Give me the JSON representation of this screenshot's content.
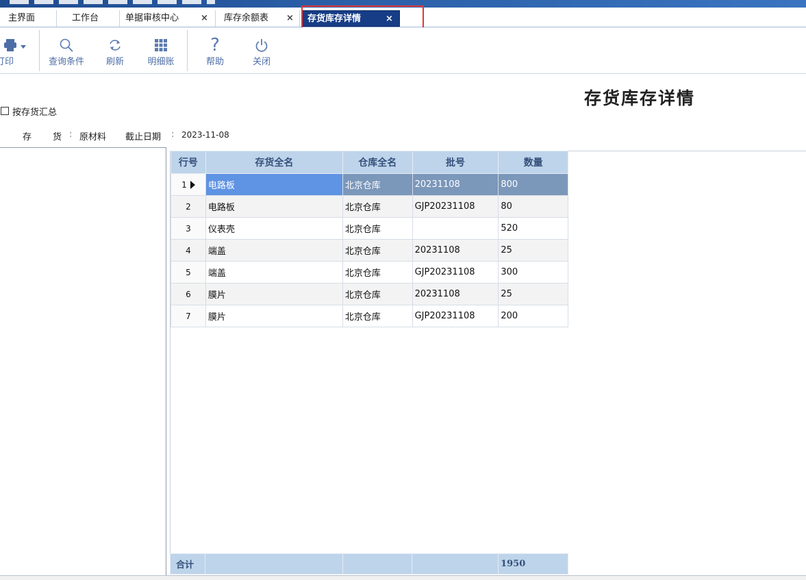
{
  "tabs": [
    {
      "label": "主界面",
      "closable": false,
      "active": false
    },
    {
      "label": "工作台",
      "closable": false,
      "active": false
    },
    {
      "label": "单据审核中心",
      "closable": true,
      "active": false
    },
    {
      "label": "库存余额表",
      "closable": true,
      "active": false
    },
    {
      "label": "存货库存详情",
      "closable": true,
      "active": true
    }
  ],
  "tab_close_glyph": "×",
  "toolbar": {
    "print": "打印",
    "query": "查询条件",
    "refresh": "刷新",
    "detail": "明细账",
    "help": "帮助",
    "close": "关闭"
  },
  "page_title": "存货库存详情",
  "summary_checkbox": {
    "label": "按存货汇总",
    "checked": false
  },
  "filters": {
    "inventory_label": "存",
    "inventory_label2": "货",
    "inventory_sep": ":",
    "inventory_value": "原材料",
    "date_label": "截止日期",
    "date_sep": ":",
    "date_value": "2023-11-08"
  },
  "table": {
    "columns": [
      "行号",
      "存货全名",
      "仓库全名",
      "批号",
      "数量"
    ],
    "rows": [
      {
        "no": "1",
        "name": "电路板",
        "warehouse": "北京仓库",
        "batch": "20231108",
        "qty": "800"
      },
      {
        "no": "2",
        "name": "电路板",
        "warehouse": "北京仓库",
        "batch": "GJP20231108",
        "qty": "80"
      },
      {
        "no": "3",
        "name": "仪表壳",
        "warehouse": "北京仓库",
        "batch": "",
        "qty": "520"
      },
      {
        "no": "4",
        "name": "端盖",
        "warehouse": "北京仓库",
        "batch": "20231108",
        "qty": "25"
      },
      {
        "no": "5",
        "name": "端盖",
        "warehouse": "北京仓库",
        "batch": "GJP20231108",
        "qty": "300"
      },
      {
        "no": "6",
        "name": "膜片",
        "warehouse": "北京仓库",
        "batch": "20231108",
        "qty": "25"
      },
      {
        "no": "7",
        "name": "膜片",
        "warehouse": "北京仓库",
        "batch": "GJP20231108",
        "qty": "200"
      }
    ],
    "selected_row": 0,
    "total_label": "合计",
    "total_qty": "1950"
  },
  "colors": {
    "active_tab": "#163d86",
    "header_bg": "#bed4ea",
    "selected_row": "#7b97ba",
    "selected_cell": "#5f93e3",
    "highlight_box": "#e23636"
  }
}
